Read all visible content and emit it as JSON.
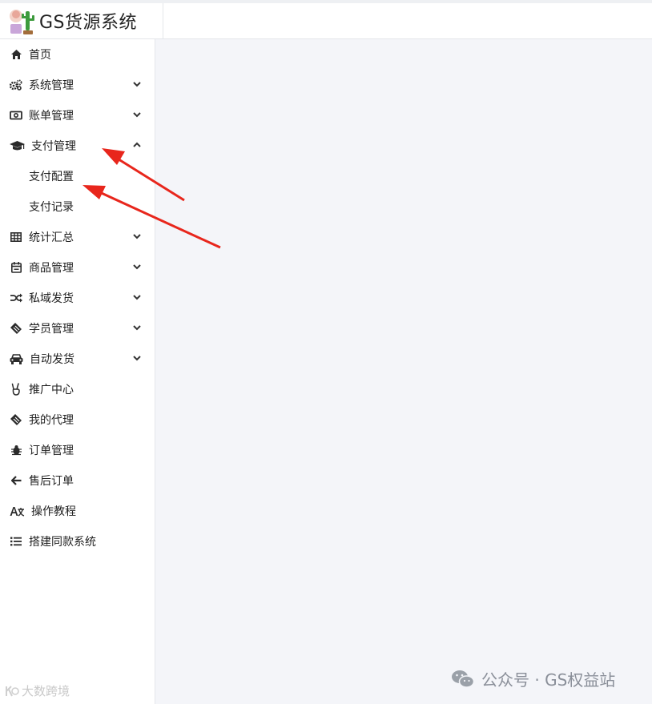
{
  "app": {
    "title": "GS货源系统"
  },
  "sidebar": {
    "items": [
      {
        "label": "首页",
        "icon": "home-icon"
      },
      {
        "label": "系统管理",
        "icon": "gears-icon",
        "expandable": true
      },
      {
        "label": "账单管理",
        "icon": "money-bill-icon",
        "expandable": true
      },
      {
        "label": "支付管理",
        "icon": "graduation-cap-icon",
        "expandable": true,
        "expanded": true,
        "children": [
          {
            "label": "支付配置"
          },
          {
            "label": "支付记录"
          }
        ]
      },
      {
        "label": "统计汇总",
        "icon": "table-icon",
        "expandable": true
      },
      {
        "label": "商品管理",
        "icon": "calendar-icon",
        "expandable": true
      },
      {
        "label": "私域发货",
        "icon": "shuffle-icon",
        "expandable": true
      },
      {
        "label": "学员管理",
        "icon": "ticket-icon",
        "expandable": true
      },
      {
        "label": "自动发货",
        "icon": "car-icon",
        "expandable": true
      },
      {
        "label": "推广中心",
        "icon": "peace-hand-icon"
      },
      {
        "label": "我的代理",
        "icon": "ticket-icon"
      },
      {
        "label": "订单管理",
        "icon": "bug-icon"
      },
      {
        "label": "售后订单",
        "icon": "arrow-left-icon"
      },
      {
        "label": "操作教程",
        "icon": "translate-icon"
      },
      {
        "label": "搭建同款系统",
        "icon": "list-icon"
      }
    ]
  },
  "watermarks": {
    "left": "大数跨境",
    "right": "公众号 · GS权益站"
  },
  "colors": {
    "main_bg": "#f4f5f9",
    "arrow": "#e8261c"
  }
}
